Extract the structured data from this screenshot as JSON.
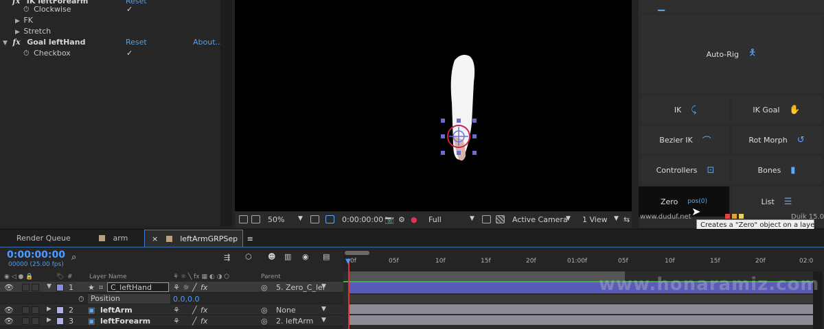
{
  "effects": {
    "top_group": "IK leftForearm",
    "top_reset": "Reset",
    "clockwise_label": "Clockwise",
    "clockwise_value": "✓",
    "fk_label": "FK",
    "stretch_label": "Stretch",
    "goal_title": "Goal leftHand",
    "goal_reset": "Reset",
    "goal_about": "About...",
    "checkbox_label": "Checkbox",
    "checkbox_value": "✓",
    "fx_mark": "fx"
  },
  "viewer_bar": {
    "zoom": "50%",
    "timecode": "0:00:00:00",
    "resolution": "Full",
    "camera": "Active Camera",
    "view": "1 View"
  },
  "duik": {
    "autorig": "Auto-Rig",
    "ik": "IK",
    "ik_goal": "IK Goal",
    "bezier_ik": "Bezier IK",
    "rot_morph": "Rot Morph",
    "controllers": "Controllers",
    "bones": "Bones",
    "zero": "Zero",
    "zero_sub": "pos(0)",
    "list": "List",
    "website": "www.duduf.net",
    "version": "Duik 15.07",
    "tooltip": "Creates a \"Zero\" object on a layer"
  },
  "tabs": [
    {
      "label": "Render Queue"
    },
    {
      "label": "arm"
    },
    {
      "label": "leftArmGRPSep"
    }
  ],
  "tab_close": "×",
  "tab_menu": "≡",
  "timeline": {
    "timecode": "0:00:00:00",
    "fps": "00000 (25.00 fps)",
    "col_layer_name": "Layer Name",
    "col_num": "#",
    "col_parent": "Parent",
    "layers": [
      {
        "num": "1",
        "name": "C_leftHand",
        "parent": "5. Zero_C_lef",
        "color": "#8a8adf"
      },
      {
        "num": "2",
        "name": "leftArm",
        "parent": "None",
        "color": "#b0b0e6"
      },
      {
        "num": "3",
        "name": "leftForearm",
        "parent": "2. leftArm",
        "color": "#b0b0e6"
      }
    ],
    "position_label": "Position",
    "position_value": "0.0,0.0",
    "ruler": [
      "05f",
      "10f",
      "15f",
      "20f",
      "01:00f",
      "05f",
      "10f",
      "15f",
      "20f",
      "02:0"
    ],
    "ruler_start": "0f"
  },
  "watermark": "www.honaramiz.com",
  "colors": {
    "accent_blue": "#4f9bff",
    "duik_icon": "#5ba8ff",
    "track_blue": "#5a5ab8",
    "playhead": "#dd3333"
  }
}
